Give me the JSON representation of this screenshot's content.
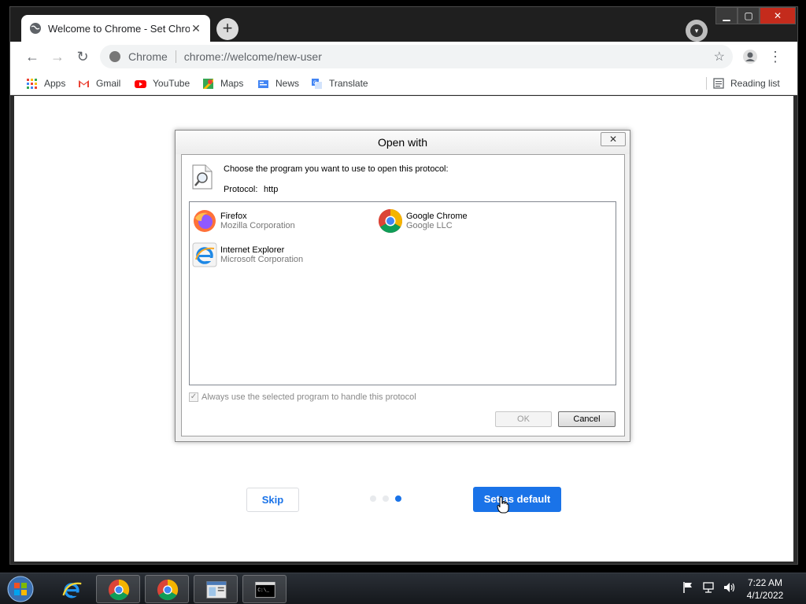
{
  "browser": {
    "tab_title": "Welcome to Chrome - Set Chrome as your default browser",
    "omnibox_site": "Chrome",
    "omnibox_url": "chrome://welcome/new-user",
    "bookmarks": [
      {
        "label": "Apps",
        "icon": "apps-grid-icon"
      },
      {
        "label": "Gmail",
        "icon": "gmail-icon"
      },
      {
        "label": "YouTube",
        "icon": "youtube-icon"
      },
      {
        "label": "Maps",
        "icon": "maps-icon"
      },
      {
        "label": "News",
        "icon": "news-icon"
      },
      {
        "label": "Translate",
        "icon": "translate-icon"
      }
    ],
    "reading_list": "Reading list"
  },
  "page": {
    "skip_label": "Skip",
    "set_default_label": "Set as default",
    "step_total": 3,
    "step_active": 3,
    "accent": "#1a73e8"
  },
  "dialog": {
    "title": "Open with",
    "close": "✕",
    "instruction": "Choose the program you want to use to open this protocol:",
    "protocol_label": "Protocol:",
    "protocol_value": "http",
    "programs": [
      {
        "name": "Firefox",
        "company": "Mozilla Corporation",
        "icon": "firefox-icon"
      },
      {
        "name": "Google Chrome",
        "company": "Google LLC",
        "icon": "chrome-icon"
      },
      {
        "name": "Internet Explorer",
        "company": "Microsoft Corporation",
        "icon": "internet-explorer-icon"
      }
    ],
    "always_use": "Always use the selected program to handle this protocol",
    "ok": "OK",
    "cancel": "Cancel"
  },
  "taskbar": {
    "time": "7:22 AM",
    "date": "4/1/2022"
  }
}
